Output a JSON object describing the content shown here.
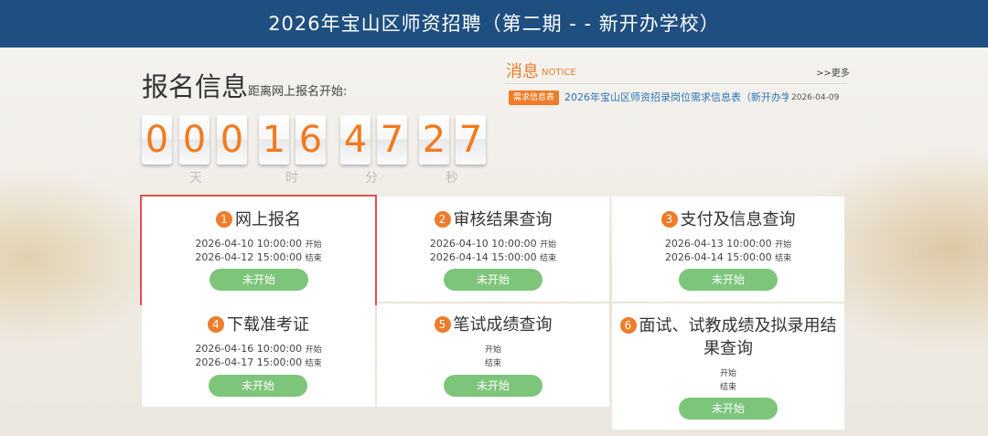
{
  "header": {
    "title": "2026年宝山区师资招聘（第二期 - - 新开办学校）"
  },
  "registration": {
    "title": "报名信息",
    "subtitle": "距离网上报名开始:",
    "countdown": {
      "digits": [
        "0",
        "0",
        "0",
        "1",
        "6",
        "4",
        "7",
        "2",
        "7"
      ],
      "labels": {
        "days": "天",
        "hours": "时",
        "minutes": "分",
        "seconds": "秒"
      }
    }
  },
  "notice": {
    "title": "消息",
    "title_en": "NOTICE",
    "more": ">>更多",
    "items": [
      {
        "tag": "需求信息表",
        "text": "2026年宝山区师资招录岗位需求信息表（新开办学...",
        "date": "2026-04-09"
      }
    ]
  },
  "steps": [
    {
      "num": "1",
      "title": "网上报名",
      "start": "2026-04-10 10:00:00",
      "start_suffix": "开始",
      "end": "2026-04-12 15:00:00",
      "end_suffix": "结束",
      "button": "未开始"
    },
    {
      "num": "2",
      "title": "审核结果查询",
      "start": "2026-04-10 10:00:00",
      "start_suffix": "开始",
      "end": "2026-04-14 15:00:00",
      "end_suffix": "结束",
      "button": "未开始"
    },
    {
      "num": "3",
      "title": "支付及信息查询",
      "start": "2026-04-13 10:00:00",
      "start_suffix": "开始",
      "end": "2026-04-14 15:00:00",
      "end_suffix": "结束",
      "button": "未开始"
    },
    {
      "num": "4",
      "title": "下载准考证",
      "start": "2026-04-16 10:00:00",
      "start_suffix": "开始",
      "end": "2026-04-17 15:00:00",
      "end_suffix": "结束",
      "button": "未开始"
    },
    {
      "num": "5",
      "title": "笔试成绩查询",
      "start": "",
      "start_suffix": "开始",
      "end": "",
      "end_suffix": "结束",
      "button": "未开始"
    },
    {
      "num": "6",
      "title": "面试、试教成绩及拟录用结",
      "title2": "果查询",
      "start": "",
      "start_suffix": "开始",
      "end": "",
      "end_suffix": "结束",
      "button": "未开始"
    }
  ],
  "colors": {
    "header": "#1e4f80",
    "accent": "#ef7c2a",
    "button": "#7ec57c",
    "selected_outline": "#e0504f",
    "link": "#2a73b8"
  }
}
